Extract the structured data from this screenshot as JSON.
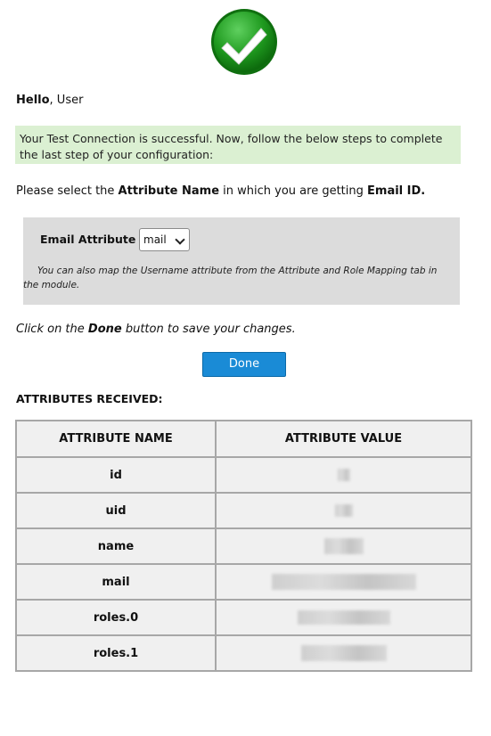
{
  "header": {
    "logo_icon": "checkmark-success-icon",
    "greeting_bold": "Hello",
    "greeting_rest": ", User"
  },
  "success_message": "Your Test Connection is successful. Now, follow the below steps to complete the last step of your configuration:",
  "instruction": {
    "part1": "Please select the ",
    "bold1": "Attribute Name",
    "part2": " in which you are getting ",
    "bold2": "Email ID."
  },
  "email_attribute": {
    "label": "Email Attribute",
    "selected": "mail",
    "note": "You can also map the Username attribute from the Attribute and Role Mapping tab in the module."
  },
  "click_note": {
    "part1": "Click on the ",
    "bold": "Done",
    "part2": " button to save your changes."
  },
  "done_label": "Done",
  "attributes": {
    "heading": "ATTRIBUTES RECEIVED:",
    "columns": [
      "ATTRIBUTE NAME",
      "ATTRIBUTE VALUE"
    ],
    "rows": [
      {
        "name": "id"
      },
      {
        "name": "uid"
      },
      {
        "name": "name"
      },
      {
        "name": "mail"
      },
      {
        "name": "roles.0"
      },
      {
        "name": "roles.1"
      }
    ]
  },
  "colors": {
    "success_bg": "#dbf0d2",
    "button_blue": "#1a8bd6",
    "panel_gray": "#dcdcdc",
    "check_green": "#2aa52a"
  }
}
